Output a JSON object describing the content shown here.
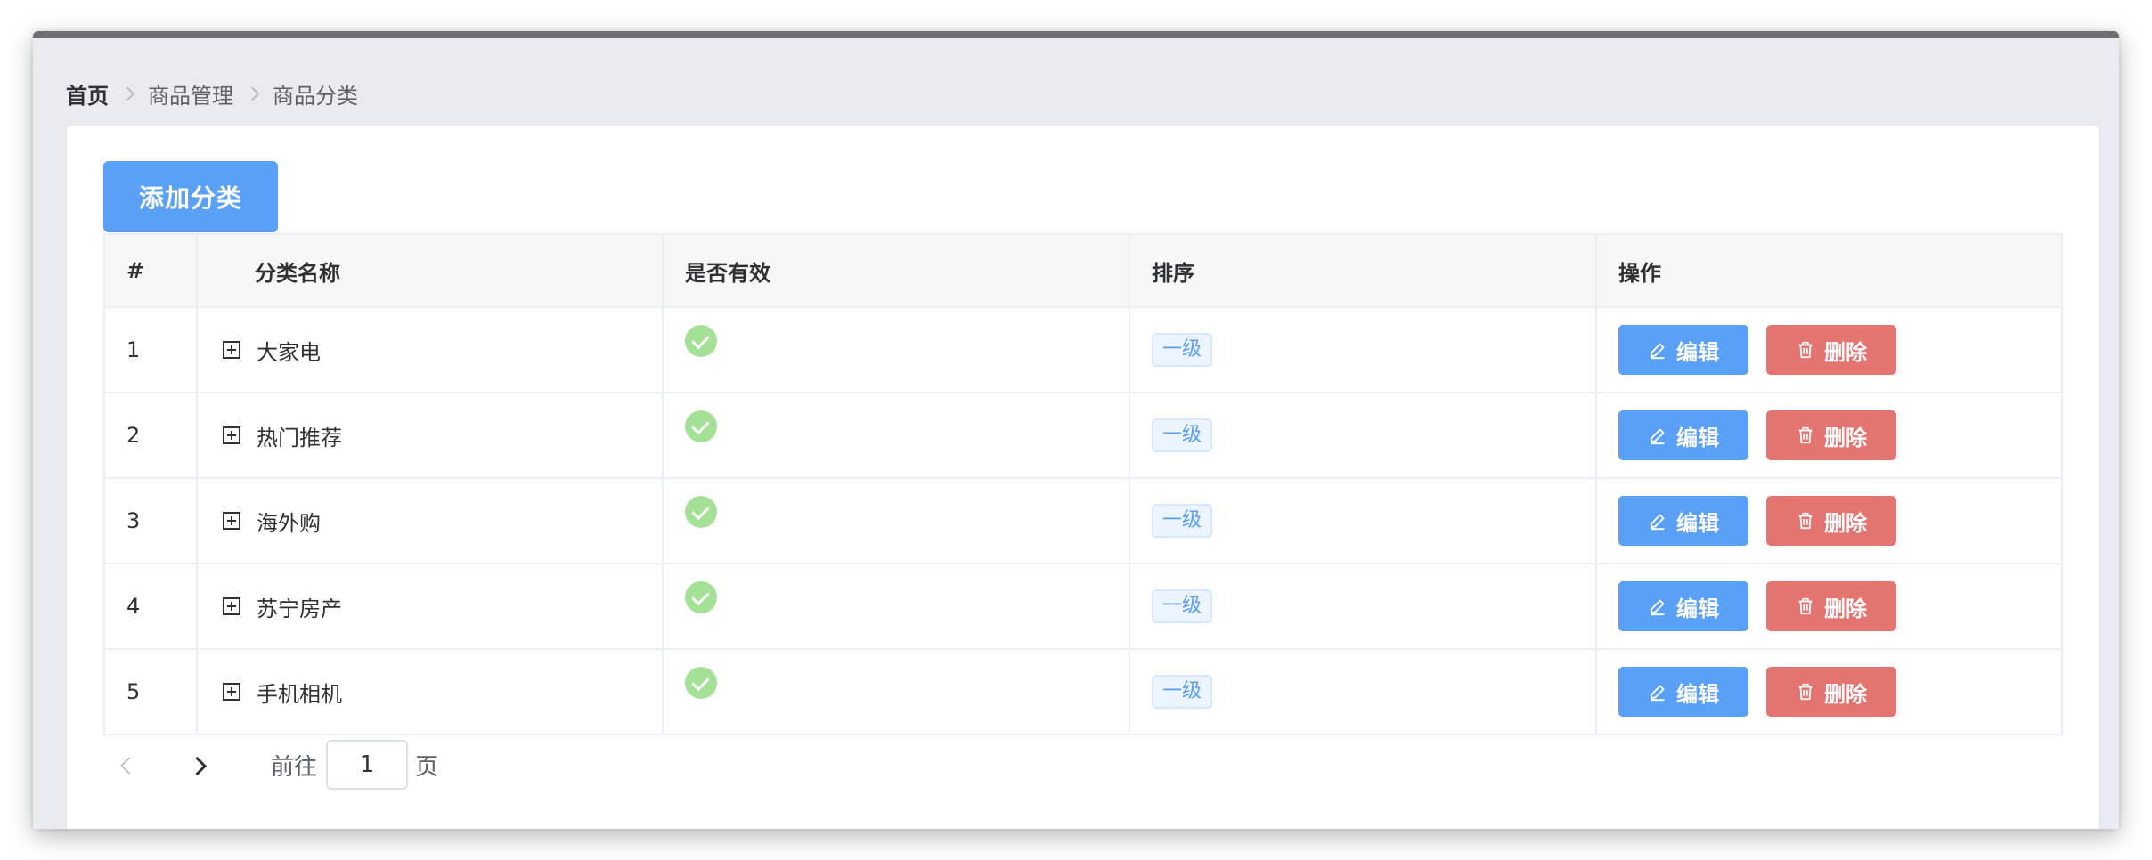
{
  "breadcrumb": [
    "首页",
    "商品管理",
    "商品分类"
  ],
  "add_button": "添加分类",
  "table": {
    "headers": [
      "#",
      "分类名称",
      "是否有效",
      "排序",
      "操作"
    ],
    "rows": [
      {
        "index": "1",
        "name": "大家电",
        "valid": true,
        "level": "一级"
      },
      {
        "index": "2",
        "name": "热门推荐",
        "valid": true,
        "level": "一级"
      },
      {
        "index": "3",
        "name": "海外购",
        "valid": true,
        "level": "一级"
      },
      {
        "index": "4",
        "name": "苏宁房产",
        "valid": true,
        "level": "一级"
      },
      {
        "index": "5",
        "name": "手机相机",
        "valid": true,
        "level": "一级"
      }
    ],
    "edit_label": "编辑",
    "delete_label": "删除"
  },
  "pagination": {
    "goto_label": "前往",
    "page_value": "1",
    "page_suffix": "页"
  },
  "colors": {
    "primary": "#59a0f6",
    "danger": "#e47470",
    "success": "#a4e095",
    "tag_text": "#5a9ff5",
    "tag_bg": "#ecf4ff"
  },
  "icons": {
    "expand": "expand-plus-icon",
    "valid": "check-circle-icon",
    "edit": "edit-pencil-icon",
    "delete": "trash-icon",
    "prev": "chevron-left-icon",
    "next": "chevron-right-icon",
    "separator": "chevron-right-icon"
  }
}
